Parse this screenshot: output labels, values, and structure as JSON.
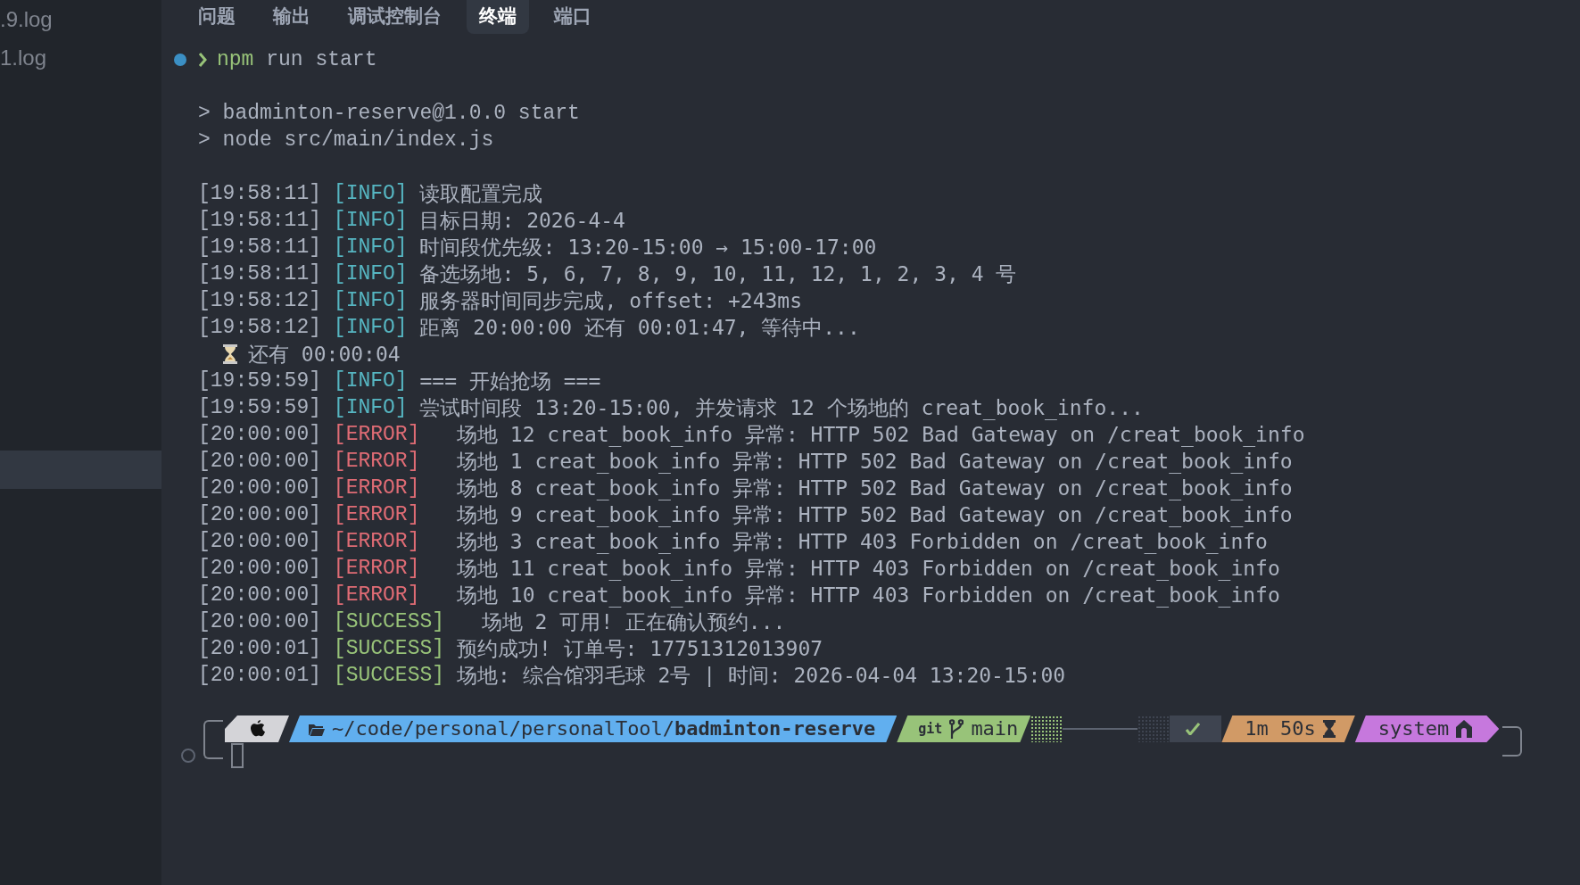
{
  "sidebar": {
    "items": [
      {
        "label": ".9.log",
        "selected": false
      },
      {
        "label": "1.log",
        "selected": false
      },
      {
        "selected": true
      }
    ]
  },
  "panel_tabs": [
    {
      "label": "问题",
      "selected": false
    },
    {
      "label": "输出",
      "selected": false
    },
    {
      "label": "调试控制台",
      "selected": false
    },
    {
      "label": "终端",
      "selected": true
    },
    {
      "label": "端口",
      "selected": false
    }
  ],
  "terminal": {
    "command": {
      "program": "npm",
      "args": "run start"
    },
    "script_lines": [
      "> badminton-reserve@1.0.0 start",
      "> node src/main/index.js"
    ],
    "log": [
      {
        "kind": "info",
        "time": "[19:58:11]",
        "level": "[INFO]",
        "message": "读取配置完成"
      },
      {
        "kind": "info",
        "time": "[19:58:11]",
        "level": "[INFO]",
        "message": "目标日期: 2026-4-4"
      },
      {
        "kind": "info",
        "time": "[19:58:11]",
        "level": "[INFO]",
        "message": "时间段优先级: 13:20-15:00 → 15:00-17:00"
      },
      {
        "kind": "info",
        "time": "[19:58:11]",
        "level": "[INFO]",
        "message": "备选场地: 5, 6, 7, 8, 9, 10, 11, 12, 1, 2, 3, 4 号"
      },
      {
        "kind": "info",
        "time": "[19:58:12]",
        "level": "[INFO]",
        "message": "服务器时间同步完成, offset: +243ms"
      },
      {
        "kind": "info",
        "time": "[19:58:12]",
        "level": "[INFO]",
        "message": "距离 20:00:00 还有 00:01:47, 等待中..."
      },
      {
        "kind": "countdown",
        "message": "还有 00:00:04"
      },
      {
        "kind": "info",
        "time": "[19:59:59]",
        "level": "[INFO]",
        "message": "=== 开始抢场 ==="
      },
      {
        "kind": "info",
        "time": "[19:59:59]",
        "level": "[INFO]",
        "message": "尝试时间段 13:20-15:00, 并发请求 12 个场地的 creat_book_info..."
      },
      {
        "kind": "error",
        "time": "[20:00:00]",
        "level": "[ERROR]",
        "message": "  场地 12 creat_book_info 异常: HTTP 502 Bad Gateway on /creat_book_info"
      },
      {
        "kind": "error",
        "time": "[20:00:00]",
        "level": "[ERROR]",
        "message": "  场地 1 creat_book_info 异常: HTTP 502 Bad Gateway on /creat_book_info"
      },
      {
        "kind": "error",
        "time": "[20:00:00]",
        "level": "[ERROR]",
        "message": "  场地 8 creat_book_info 异常: HTTP 502 Bad Gateway on /creat_book_info"
      },
      {
        "kind": "error",
        "time": "[20:00:00]",
        "level": "[ERROR]",
        "message": "  场地 9 creat_book_info 异常: HTTP 502 Bad Gateway on /creat_book_info"
      },
      {
        "kind": "error",
        "time": "[20:00:00]",
        "level": "[ERROR]",
        "message": "  场地 3 creat_book_info 异常: HTTP 403 Forbidden on /creat_book_info"
      },
      {
        "kind": "error",
        "time": "[20:00:00]",
        "level": "[ERROR]",
        "message": "  场地 11 creat_book_info 异常: HTTP 403 Forbidden on /creat_book_info"
      },
      {
        "kind": "error",
        "time": "[20:00:00]",
        "level": "[ERROR]",
        "message": "  场地 10 creat_book_info 异常: HTTP 403 Forbidden on /creat_book_info"
      },
      {
        "kind": "success",
        "time": "[20:00:00]",
        "level": "[SUCCESS]",
        "message": "  场地 2 可用! 正在确认预约..."
      },
      {
        "kind": "success",
        "time": "[20:00:01]",
        "level": "[SUCCESS]",
        "message": "预约成功! 订单号: 17751312013907"
      },
      {
        "kind": "success",
        "time": "[20:00:01]",
        "level": "[SUCCESS]",
        "message": "场地: 综合馆羽毛球 2号 | 时间: 2026-04-04 13:20-15:00"
      }
    ],
    "prompt": {
      "left": [
        {
          "kind": "os",
          "color": "#d4d4d8"
        },
        {
          "kind": "path",
          "color": "#61afef",
          "text": "~/code/personal/personalTool/",
          "bold": "badminton-reserve"
        },
        {
          "kind": "git",
          "color": "#98c379",
          "label": "git",
          "text": "main"
        }
      ],
      "right": [
        {
          "kind": "status",
          "color": "#3e4450"
        },
        {
          "kind": "duration",
          "color": "#d19a66",
          "text": "1m 50s"
        },
        {
          "kind": "context",
          "color": "#c678dd",
          "text": "system"
        }
      ]
    }
  }
}
